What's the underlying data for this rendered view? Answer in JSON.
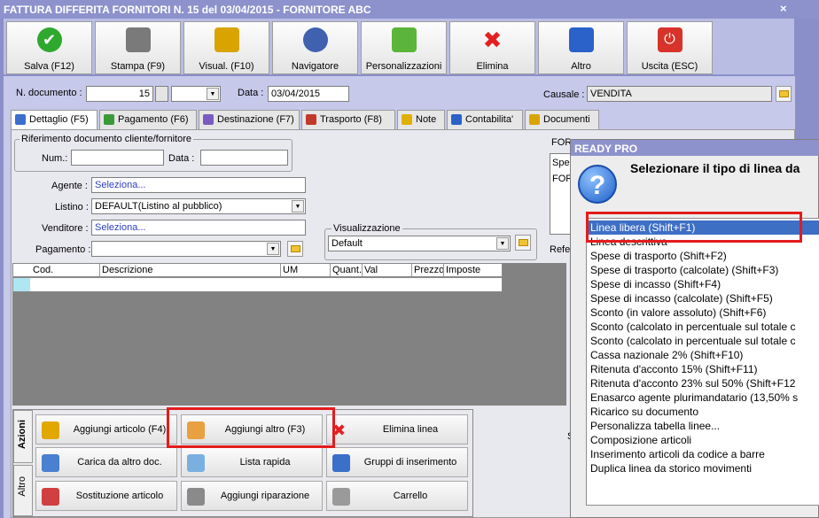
{
  "window": {
    "title": "FATTURA DIFFERITA FORNITORI N. 15 del 03/04/2015 - FORNITORE ABC",
    "close": "×"
  },
  "toolbar": [
    {
      "label": "Salva (F12)",
      "icon": "check-icon",
      "color": "#2fa82f"
    },
    {
      "label": "Stampa (F9)",
      "icon": "printer-icon",
      "color": "#7a7a7a"
    },
    {
      "label": "Visual. (F10)",
      "icon": "magic-wand-icon",
      "color": "#d9a400"
    },
    {
      "label": "Navigatore",
      "icon": "compass-icon",
      "color": "#4060b0"
    },
    {
      "label": "Personalizzazioni",
      "icon": "puzzle-icon",
      "color": "#5bb53a"
    },
    {
      "label": "Elimina",
      "icon": "delete-x-icon",
      "color": "#e32020"
    },
    {
      "label": "Altro",
      "icon": "search-icon",
      "color": "#2a62c9"
    },
    {
      "label": "Uscita (ESC)",
      "icon": "power-icon",
      "color": "#d8332a"
    }
  ],
  "header": {
    "n_documento_label": "N. documento :",
    "n_documento": "15",
    "data_label": "Data :",
    "data": "03/04/2015",
    "causale_label": "Causale :",
    "causale": "VENDITA"
  },
  "tabs": [
    "Dettaglio (F5)",
    "Pagamento (F6)",
    "Destinazione (F7)",
    "Trasporto (F8)",
    "Note",
    "Contabilita'",
    "Documenti"
  ],
  "riferimento": {
    "title": "Riferimento documento cliente/fornitore",
    "num_label": "Num.:",
    "data_label": "Data :"
  },
  "fields": {
    "agente_label": "Agente :",
    "agente": "Seleziona...",
    "listino_label": "Listino :",
    "listino": "DEFAULT(Listino al pubblico)",
    "venditore_label": "Venditore :",
    "venditore": "Seleziona...",
    "pagamento_label": "Pagamento :",
    "visualizzazione_label": "Visualizzazione",
    "visualizzazione": "Default"
  },
  "right_partial": {
    "for1": "FOR",
    "spe": "Spe",
    "for2": "FOR",
    "refe": "Refe"
  },
  "grid": {
    "columns": [
      "Cod.",
      "Descrizione",
      "UM",
      "Quant.",
      "Val",
      "Prezzo",
      "Imposte"
    ]
  },
  "actions": {
    "vtab_azioni": "Azioni",
    "vtab_altro": "Altro",
    "buttons": [
      {
        "label": "Aggiungi articolo (F4)",
        "icon": "add-box-icon"
      },
      {
        "label": "Aggiungi altro (F3)",
        "icon": "add-grid-icon"
      },
      {
        "label": "Elimina linea",
        "icon": "delete-x-icon"
      },
      {
        "label": "Carica da altro doc.",
        "icon": "checklist-icon"
      },
      {
        "label": "Lista rapida",
        "icon": "hand-list-icon"
      },
      {
        "label": "Gruppi di inserimento",
        "icon": "group-add-icon"
      },
      {
        "label": "Sostituzione articolo",
        "icon": "swap-icon"
      },
      {
        "label": "Aggiungi riparazione",
        "icon": "wrench-icon"
      },
      {
        "label": "Carrello",
        "icon": "cart-icon"
      }
    ],
    "partial_s": "S"
  },
  "dialog": {
    "title": "READY PRO",
    "heading": "Selezionare il tipo di linea da",
    "items": [
      "Linea libera (Shift+F1)",
      "Linea descrittiva",
      "Spese di trasporto (Shift+F2)",
      "Spese di trasporto (calcolate) (Shift+F3)",
      "Spese di incasso (Shift+F4)",
      "Spese di incasso (calcolate) (Shift+F5)",
      "Sconto (in valore assoluto) (Shift+F6)",
      "Sconto (calcolato in percentuale sul totale c",
      "Sconto (calcolato in percentuale sul totale c",
      "Cassa nazionale 2% (Shift+F10)",
      "Ritenuta d'acconto 15% (Shift+F11)",
      "Ritenuta d'acconto 23% sul 50% (Shift+F12",
      "Enasarco agente plurimandatario (13,50% s",
      "Ricarico su documento",
      "Personalizza tabella linee...",
      "Composizione articoli",
      "Inserimento articoli da codice a barre",
      "Duplica linea da storico movimenti"
    ]
  },
  "colors": {
    "title_bg": "#8d92cc",
    "panel_bg": "#c6c9ea",
    "highlight": "#e31c1c",
    "selection": "#3d6fc5"
  }
}
